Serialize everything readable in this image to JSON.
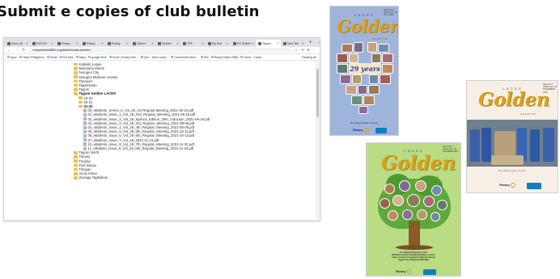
{
  "slide": {
    "title": "Submit e copies of club bulletin"
  },
  "browser": {
    "tabs": [
      {
        "label": "Inbox (6)",
        "active": false
      },
      {
        "label": "RACOG",
        "active": false
      },
      {
        "label": "Rotary",
        "active": false
      },
      {
        "label": "Rotary",
        "active": false
      },
      {
        "label": "Rotary",
        "active": false
      },
      {
        "label": "District",
        "active": false
      },
      {
        "label": "Golden",
        "active": false
      },
      {
        "label": "TRF",
        "active": false
      },
      {
        "label": "My Dist",
        "active": false
      },
      {
        "label": "RC Bulletin",
        "active": false
      },
      {
        "label": "Tagum",
        "active": true
      },
      {
        "label": "New Tab",
        "active": false
      }
    ],
    "window_controls": [
      "–",
      "□",
      "✕"
    ],
    "url": "rotarydistrict3860.org/district/clubs-bulletin/",
    "bookmarks": [
      "Apps",
      "Yahoo Philippines",
      "Gmail",
      "YouTube",
      "Maps",
      "google drive",
      "Home | Rotary Inter...",
      "Q&n - Wsd Lusoor...",
      "Documents Intern...",
      "Wix",
      "Rotary District 3860",
      "Home - Canva"
    ],
    "bookmarks_right": "Reading list",
    "tree": [
      {
        "label": "Kabisilo Logue",
        "kind": "folder",
        "level": 0,
        "bold": false
      },
      {
        "label": "Maximina Monte",
        "kind": "folder",
        "level": 0,
        "bold": false
      },
      {
        "label": "Nuruges City",
        "kind": "folder",
        "level": 0,
        "bold": false
      },
      {
        "label": "Nuruges Midtown Jewels",
        "kind": "folder",
        "level": 0,
        "bold": false
      },
      {
        "label": "Tanauan",
        "kind": "folder",
        "level": 0,
        "bold": false
      },
      {
        "label": "Tagamasan",
        "kind": "folder",
        "level": 0,
        "bold": false
      },
      {
        "label": "Tagum",
        "kind": "folder",
        "level": 0,
        "bold": false
      },
      {
        "label": "Tagum Golden LACES",
        "kind": "folder",
        "level": 0,
        "bold": true
      },
      {
        "label": "19-20",
        "kind": "folder",
        "level": 1,
        "bold": false
      },
      {
        "label": "20-21",
        "kind": "folder",
        "level": 1,
        "bold": false
      },
      {
        "label": "21-22",
        "kind": "folder",
        "level": 1,
        "bold": true
      },
      {
        "label": "00_eBulletin_Series_0_Vol_29_1st Regular Meeting_2021-06-10.pdf",
        "kind": "file",
        "level": 2,
        "bold": false
      },
      {
        "label": "01_eBulletin_Issue_1_Vol_29_2nd_Regular_Meeting_2021-06-15.pdf",
        "kind": "file",
        "level": 2,
        "bold": false
      },
      {
        "label": "02_eBulletin_Issue_2_Vol_29_Special_Edition_29th_Induction_2021-06-19.pdf",
        "kind": "file",
        "level": 2,
        "bold": false
      },
      {
        "label": "03_eBulletin_Issue_3_Vol_29_3rd_Regular_Meeting_2021-08-08.pdf",
        "kind": "file",
        "level": 2,
        "bold": false
      },
      {
        "label": "04_eBulletin_Issue_4_Vol_29_4th_Regular_Meeting_2021-08-08.pdf",
        "kind": "file",
        "level": 2,
        "bold": false
      },
      {
        "label": "05_eBulletin_Issue_5_Vol_29_5th_Regular_Meeting_2021-10-11.pdf",
        "kind": "file",
        "level": 2,
        "bold": false
      },
      {
        "label": "06_eBulletin_Issue_6_Vol_29_6th_Regular_Meeting_2021-10-13.pdf",
        "kind": "file",
        "level": 2,
        "bold": false
      },
      {
        "label": "07_eBulletin_Issue_7_Vol_29_2021-11-14.pdf",
        "kind": "file",
        "level": 2,
        "bold": false
      },
      {
        "label": "10_eBulletin_Issue_8_Vol_29_7th_Regular_Meeting_2021-11-20.pdf",
        "kind": "file",
        "level": 2,
        "bold": false
      },
      {
        "label": "11_eBulletin_Issue_9_Vol_29_8th_Regular_Meeting_2021-11-20.pdf",
        "kind": "file",
        "level": 2,
        "bold": false
      },
      {
        "label": "Tagum North",
        "kind": "folder",
        "level": 0,
        "bold": false
      },
      {
        "label": "Tanauy",
        "kind": "folder",
        "level": 0,
        "bold": false
      },
      {
        "label": "Tboling",
        "kind": "folder",
        "level": 0,
        "bold": false
      },
      {
        "label": "Toril Davao",
        "kind": "folder",
        "level": 0,
        "bold": false
      },
      {
        "label": "Trikajan",
        "kind": "folder",
        "level": 0,
        "bold": false
      },
      {
        "label": "Vicas Kikon",
        "kind": "folder",
        "level": 0,
        "bold": false
      },
      {
        "label": "Zarraga Tagbilaran",
        "kind": "folder",
        "level": 0,
        "bold": false
      }
    ]
  },
  "covers": [
    {
      "masthead": "L.A.C.E.S",
      "title": "Golden",
      "subtitle": "GAZETTE",
      "issue_lines": [
        "Issue No.0",
        "Volume No. 29",
        "JULY 2021"
      ],
      "anniversary": "29 years",
      "footer": "RC of Tagum Golden L.A.C.E.S.",
      "logos": "Rotary",
      "bg": "#9fb4da"
    },
    {
      "masthead": "L.A.C.E.S",
      "title": "Golden",
      "subtitle": "GAZETTE",
      "issue_lines": [
        "Issue No.7",
        "Volume No. 29",
        "NOVEMBER 2021"
      ],
      "footer": "RC of Tagum Golden L.A.C.E.S.",
      "logos": "Rotary",
      "bg": "#f6efe6"
    },
    {
      "masthead": "L.A.C.E.S",
      "title": "Golden",
      "subtitle": "GAZETTE",
      "issue_lines": [
        "Issue No.4",
        "Volume No. 29",
        "OCTOBER 2021"
      ],
      "footer_lines": [
        "The Official Publication of the",
        "ROTARY CLUB OF TAGUM GOLDEN L.A.C.E.S.",
        "Ladies in Action Committed to Effective Service",
        "Tagum City, Philippines RID 3860"
      ],
      "logos": "Rotary",
      "bg": "#b9dc84"
    }
  ]
}
